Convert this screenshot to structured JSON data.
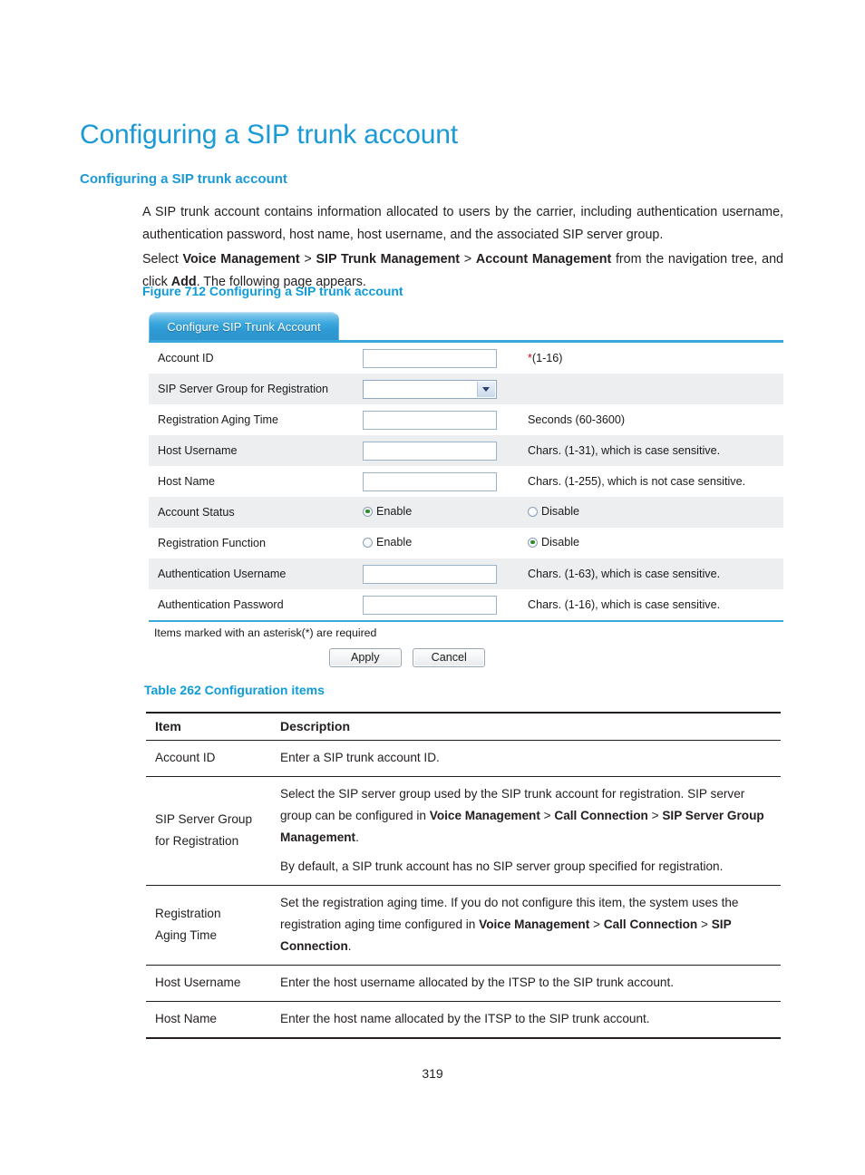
{
  "document": {
    "h1": "Configuring a SIP trunk account",
    "h2": "Configuring a SIP trunk account",
    "page_number": "319",
    "paragraph_1": "A SIP trunk account contains information allocated to users by the carrier, including authentication username, authentication password, host name, host username, and the associated SIP server group.",
    "paragraph_2_part1": "Select ",
    "paragraph_2_b1": "Voice Management",
    "paragraph_2_sep1": " > ",
    "paragraph_2_b2": "SIP Trunk Management",
    "paragraph_2_sep2": " > ",
    "paragraph_2_b3": "Account Management",
    "paragraph_2_part2": " from the navigation tree, and click ",
    "paragraph_2_b4": "Add",
    "paragraph_2_part3": ". The following page appears.",
    "figure_caption": "Figure 712 Configuring a SIP trunk account",
    "table_caption": "Table 262 Configuration items",
    "accent_blue": "#1b9ad6",
    "caption_blue": "#0e9bd8"
  },
  "figure": {
    "tab_label": "Configure SIP Trunk Account",
    "rows": [
      {
        "label": "Account ID",
        "control": "text",
        "value": "",
        "hint_star": "*",
        "hint": "(1-16)"
      },
      {
        "label": "SIP Server Group for Registration",
        "control": "select",
        "value": "",
        "hint": ""
      },
      {
        "label": "Registration Aging Time",
        "control": "text",
        "value": "",
        "hint": "Seconds (60-3600)"
      },
      {
        "label": "Host Username",
        "control": "text",
        "value": "",
        "hint": "Chars. (1-31), which is case sensitive."
      },
      {
        "label": "Host Name",
        "control": "text",
        "value": "",
        "hint": "Chars. (1-255), which is not case sensitive."
      },
      {
        "label": "Account Status",
        "control": "radio",
        "option_a": "Enable",
        "option_b": "Disable",
        "selected": "Enable"
      },
      {
        "label": "Registration Function",
        "control": "radio",
        "option_a": "Enable",
        "option_b": "Disable",
        "selected": "Disable"
      },
      {
        "label": "Authentication Username",
        "control": "text",
        "value": "",
        "hint": "Chars. (1-63), which is case sensitive."
      },
      {
        "label": "Authentication Password",
        "control": "text",
        "value": "",
        "hint": "Chars. (1-16), which is case sensitive."
      }
    ],
    "asterisk_note": "Items marked with an asterisk(*) are required",
    "apply_label": "Apply",
    "cancel_label": "Cancel"
  },
  "desc_table": {
    "header_item": "Item",
    "header_description": "Description",
    "rows": [
      {
        "item": "Account ID",
        "desc_1": "Enter a SIP trunk account ID."
      },
      {
        "item_line1": "SIP Server Group",
        "item_line2": "for Registration",
        "desc_1_a": "Select the SIP server group used by the SIP trunk account for registration. SIP server group can be configured in ",
        "desc_1_b1": "Voice Management",
        "desc_1_s1": " > ",
        "desc_1_b2": "Call Connection",
        "desc_1_s2": " > ",
        "desc_1_b3": "SIP Server Group Management",
        "desc_1_c": ".",
        "desc_2": "By default, a SIP trunk account has no SIP server group specified for registration."
      },
      {
        "item_line1": "Registration",
        "item_line2": "Aging Time",
        "desc_1_a": "Set the registration aging time. If you do not configure this item, the system uses the registration aging time configured in ",
        "desc_1_b1": "Voice Management",
        "desc_1_s1": " > ",
        "desc_1_b2": "Call Connection",
        "desc_1_s2": " > ",
        "desc_1_b3": "SIP Connection",
        "desc_1_c": "."
      },
      {
        "item": "Host Username",
        "desc_1": "Enter the host username allocated by the ITSP to the SIP trunk account."
      },
      {
        "item": "Host Name",
        "desc_1": "Enter the host name allocated by the ITSP to the SIP trunk account."
      }
    ]
  }
}
